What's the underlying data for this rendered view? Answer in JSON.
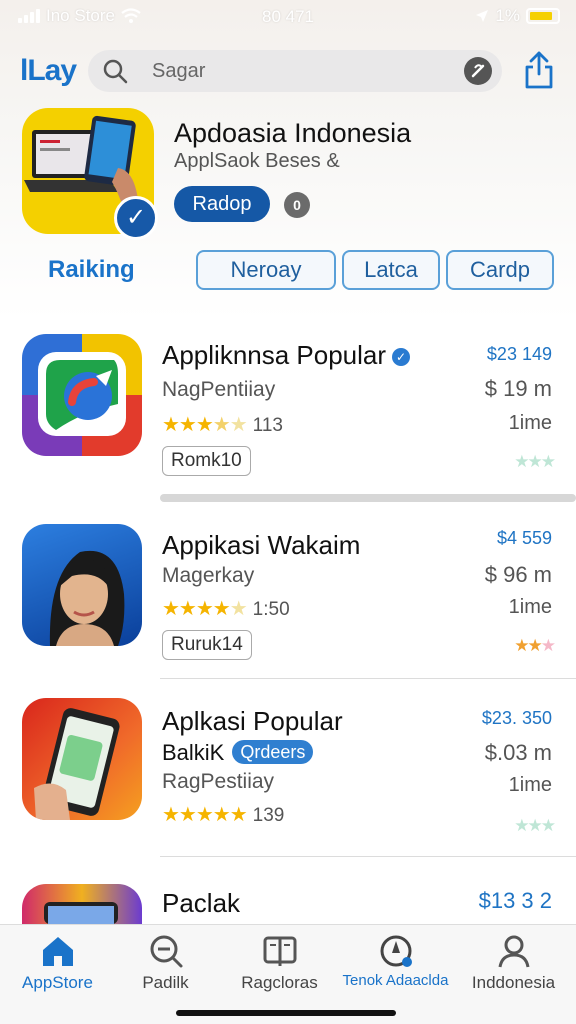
{
  "status_bar": {
    "carrier": "Ino Store",
    "time": "80 471",
    "battery_pct": "1%"
  },
  "header": {
    "logo": "lLay",
    "search_placeholder": "Sagar"
  },
  "hero": {
    "title": "Apdoasia Indonesia",
    "subtitle": "ApplSaok Beses &",
    "button": "Radop",
    "info_badge": "0"
  },
  "filters": {
    "ranking_label": "Raiking",
    "chips": [
      "Neroay",
      "Latca",
      "Cardp"
    ]
  },
  "apps": [
    {
      "name": "Appliknnsa Popular",
      "developer": "NagPentiiay",
      "rating_stars": 3.5,
      "rating_count": "113",
      "tag": "Romk10",
      "price_top": "$23 149",
      "price_main": "$ 19 m",
      "time": "1ime"
    },
    {
      "name": "Appikasi Wakaim",
      "developer": "Magerkay",
      "rating_stars": 4,
      "rating_count": "1:50",
      "tag": "Ruruk14",
      "price_top": "$4 559",
      "price_main": "$ 96 m",
      "time": "1ime"
    },
    {
      "name": "Aplkasi Popular",
      "line2": "BalkiK",
      "pill": "Qrdeers",
      "developer": "RagPestiiay",
      "rating_stars": 5,
      "rating_count": "139",
      "price_top": "$23. 350",
      "price_main": "$.03 m",
      "time": "1ime"
    },
    {
      "name": "Paclak",
      "price_top": "$13 3 2"
    }
  ],
  "tabs": [
    {
      "label": "AppStore",
      "icon": "home-icon"
    },
    {
      "label": "Padilk",
      "icon": "search-icon"
    },
    {
      "label": "Ragcloras",
      "icon": "book-icon"
    },
    {
      "label": "Tenok Adaaclda",
      "icon": "compass-icon"
    },
    {
      "label": "Inddonesia",
      "icon": "person-icon"
    }
  ],
  "colors": {
    "accent": "#1a73c9",
    "hero_bg": "#f4d000",
    "button": "#1558a6"
  }
}
